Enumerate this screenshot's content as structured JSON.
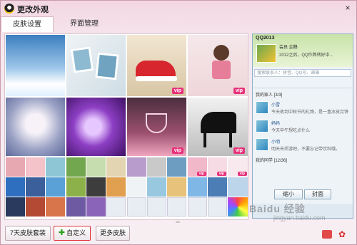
{
  "window": {
    "title": "更改外观",
    "close_label": "×"
  },
  "tabs": [
    {
      "label": "皮肤设置"
    },
    {
      "label": "界面管理"
    }
  ],
  "skins": {
    "vip_label": "vip",
    "large": [
      {
        "name": "sky-clouds-skin"
      },
      {
        "name": "photo-clothesline-skin"
      },
      {
        "name": "red-sneaker-skin",
        "vip": true
      },
      {
        "name": "girl-cartoon-skin",
        "vip": true
      },
      {
        "name": "white-blossom-skin"
      },
      {
        "name": "purple-flower-skin"
      },
      {
        "name": "pink-glass-skin",
        "vip": true
      },
      {
        "name": "piano-skin",
        "vip": true
      }
    ]
  },
  "buttons": {
    "seven_day": "7天皮肤套装",
    "custom": "自定义",
    "custom_icon": "plus-icon",
    "more": "更多皮肤"
  },
  "preview": {
    "title": "QQ2013",
    "name": "会员 企鹅",
    "signature": "2012之后，QQ作弊转好中...",
    "search_placeholder": "搜索联系人：拼音、QQ号、邮箱",
    "groups": [
      {
        "label": "我的家人 [3/3]"
      },
      {
        "label": "我的同学 [12/36]"
      }
    ],
    "contacts": [
      {
        "name": "小雪",
        "message": "今天收到中秋节的礼物，是一盒冰皮月饼"
      },
      {
        "name": "妈妈",
        "message": "今天中午想吃点什么"
      },
      {
        "name": "小明",
        "message": "明天去郊游吧，不要忘记带饮料哦。"
      }
    ],
    "btn_left": "缩小",
    "btn_right": "封面"
  },
  "watermark": {
    "line1": "Baidu 经验",
    "line2": "jingyan.baidu.com"
  }
}
